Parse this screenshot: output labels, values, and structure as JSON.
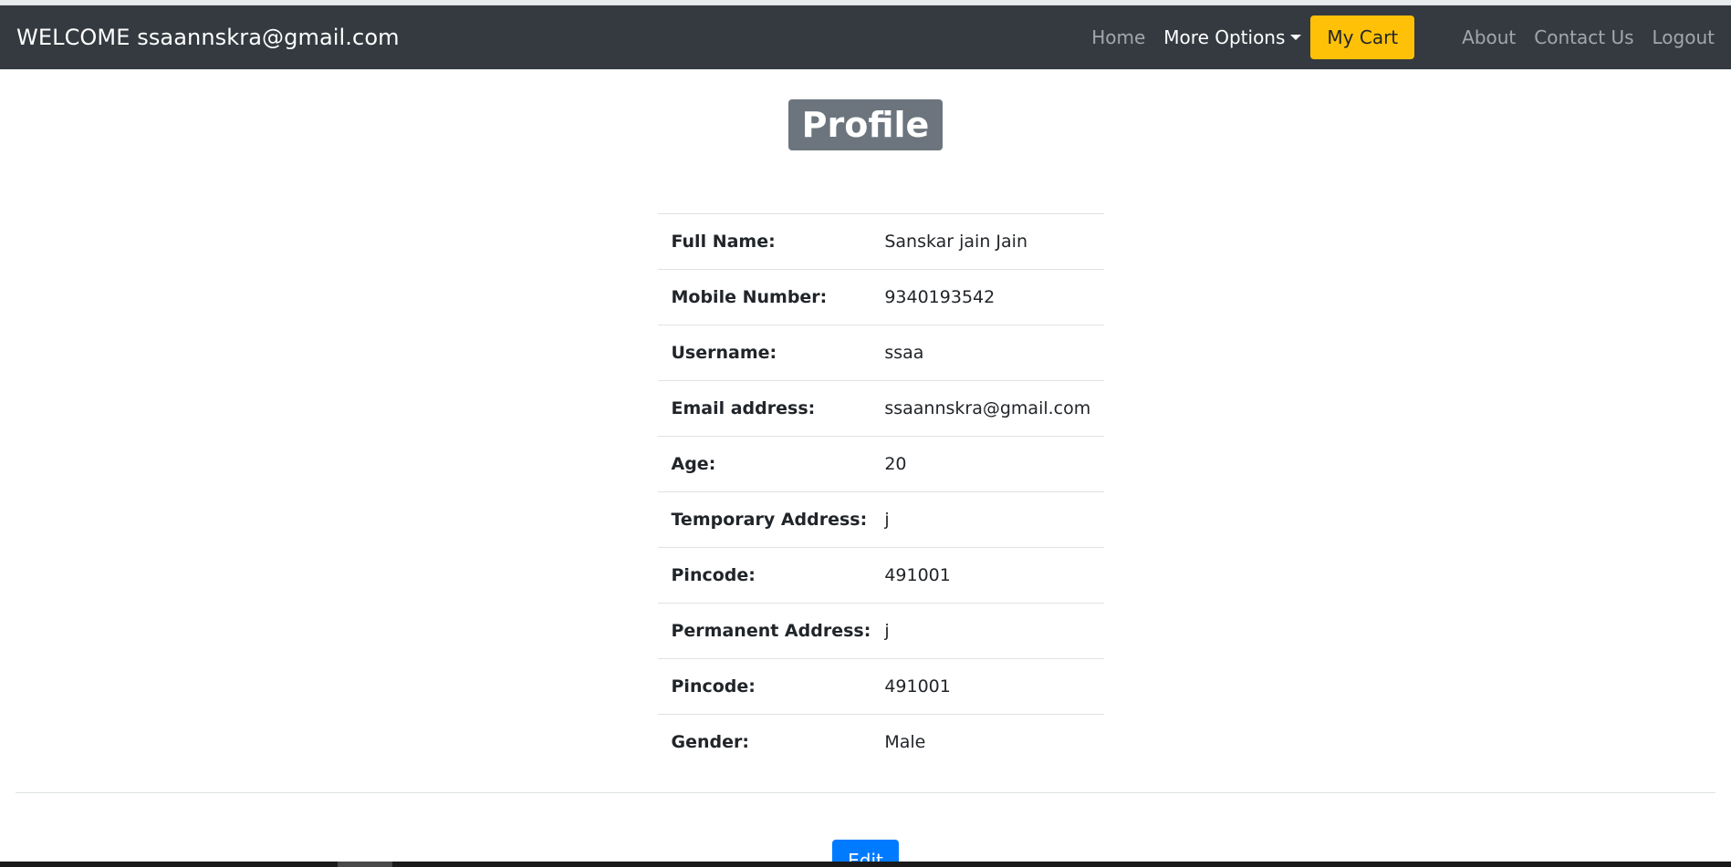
{
  "header": {
    "welcome_text": "WELCOME ssaannskra@gmail.com",
    "nav": {
      "home": "Home",
      "more_options": "More Options",
      "my_cart": "My Cart",
      "about": "About",
      "contact": "Contact Us",
      "logout": "Logout"
    }
  },
  "profile": {
    "title": "Profile",
    "rows": [
      {
        "label": "Full Name:",
        "value": "Sanskar jain Jain"
      },
      {
        "label": "Mobile Number:",
        "value": "9340193542"
      },
      {
        "label": "Username:",
        "value": "ssaa"
      },
      {
        "label": "Email address:",
        "value": "ssaannskra@gmail.com"
      },
      {
        "label": "Age:",
        "value": "20"
      },
      {
        "label": "Temporary Address:",
        "value": "j"
      },
      {
        "label": "Pincode:",
        "value": "491001"
      },
      {
        "label": "Permanent Address:",
        "value": "j"
      },
      {
        "label": "Pincode:",
        "value": "491001"
      },
      {
        "label": "Gender:",
        "value": "Male"
      }
    ],
    "edit_label": "Edit"
  },
  "colors": {
    "navbar": "#343a40",
    "cart_button": "#ffc107",
    "title_badge": "#6c757d",
    "edit_button": "#007bff"
  },
  "icons": {
    "dropdown": "caret-down-icon"
  }
}
